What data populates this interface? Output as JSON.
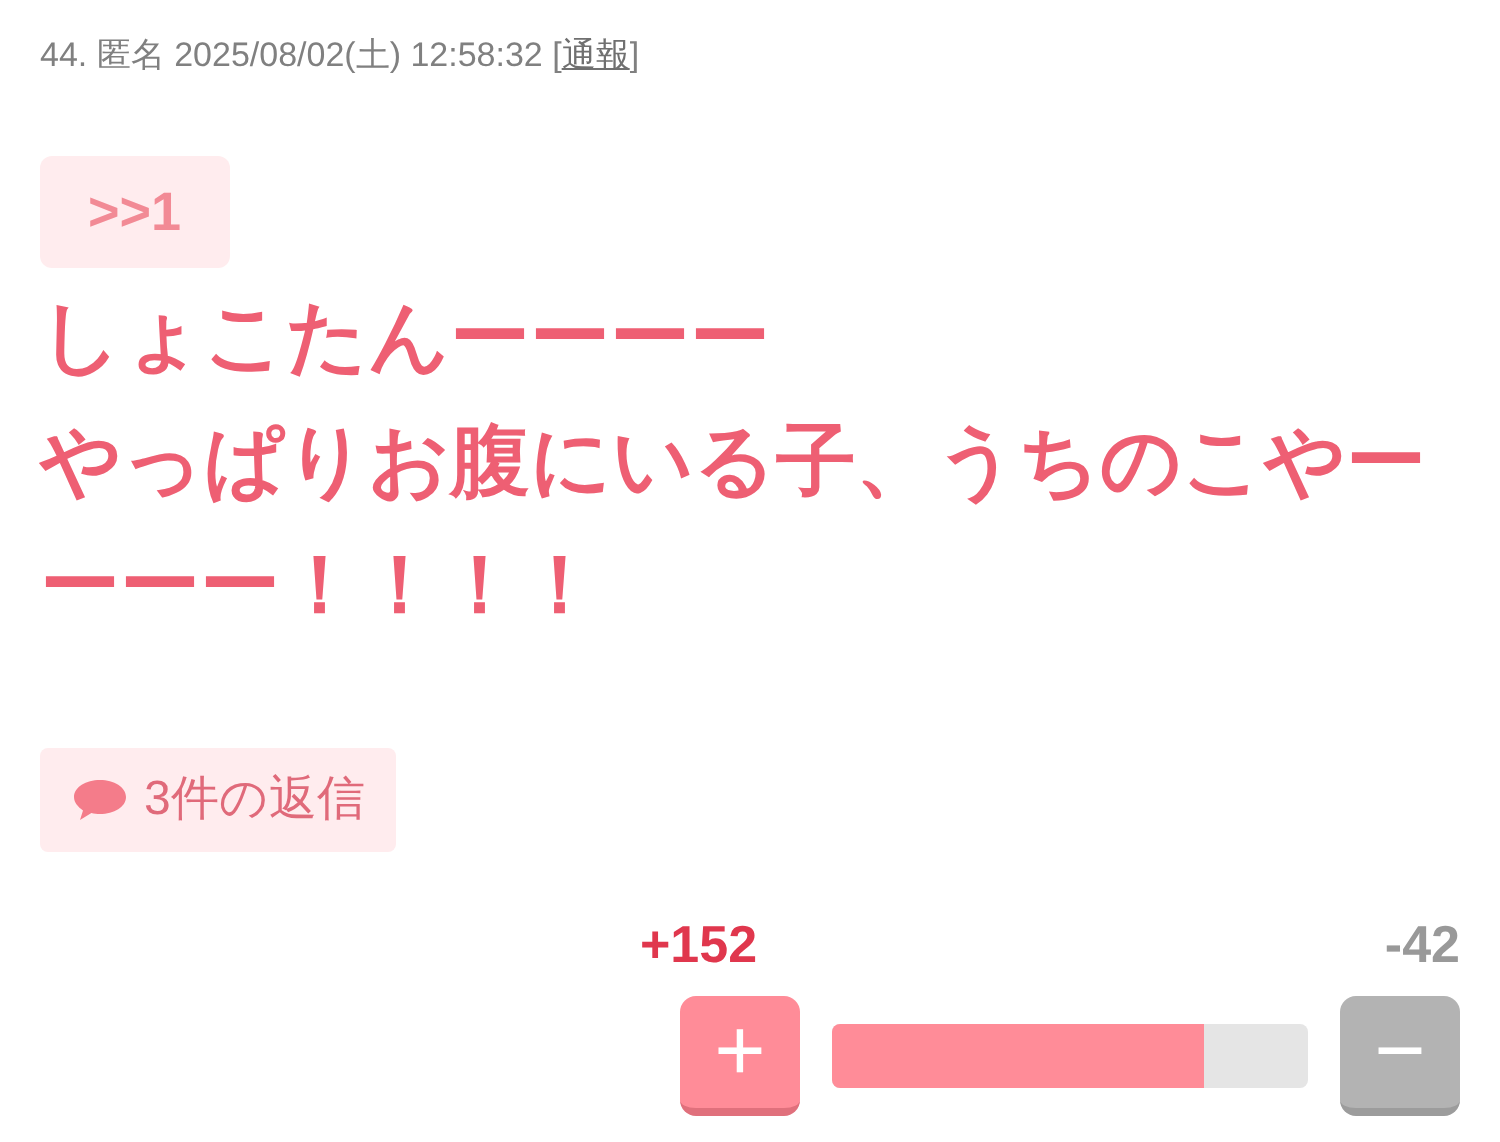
{
  "header": {
    "text": "44. 匿名 2025/08/02(土) 12:58:32 [",
    "report_link": "通報",
    "close": "]"
  },
  "anchor": ">>1",
  "body_lines": [
    "しょこたんーーーー",
    "やっぱりお腹にいる子、うちのこやーーーー！！！！"
  ],
  "replies": "3件の返信",
  "vote": {
    "plus_count": "+152",
    "minus_count": "-42",
    "plus_label": "+",
    "minus_label": "−",
    "level": 0.78
  }
}
